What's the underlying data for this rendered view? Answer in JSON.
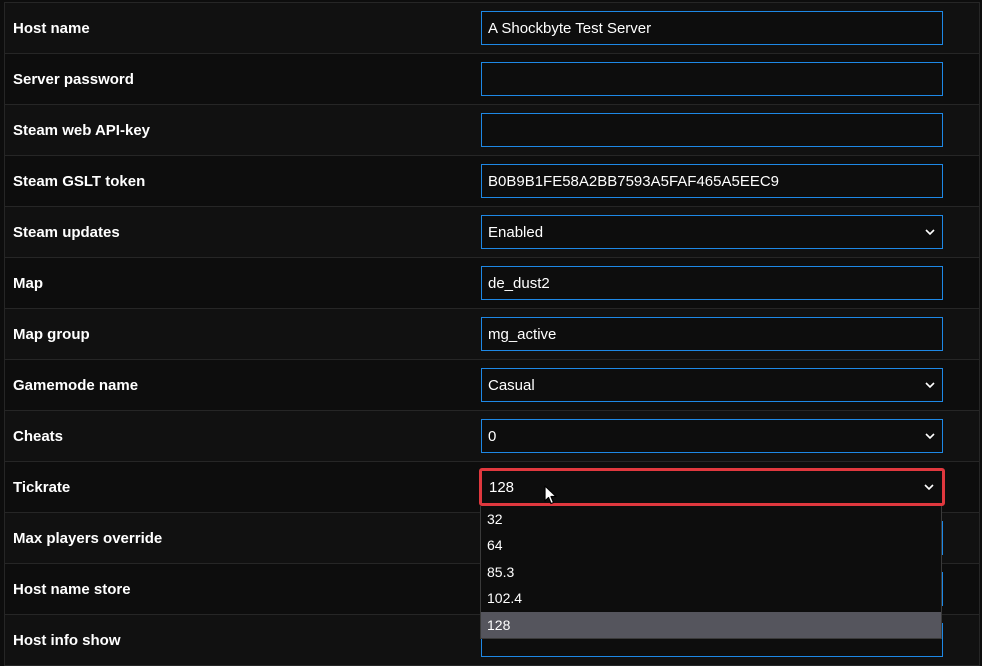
{
  "rows": [
    {
      "label": "Host name",
      "type": "input",
      "value": "A Shockbyte Test Server"
    },
    {
      "label": "Server password",
      "type": "input",
      "value": ""
    },
    {
      "label": "Steam web API-key",
      "type": "input",
      "value": ""
    },
    {
      "label": "Steam GSLT token",
      "type": "input",
      "value": "B0B9B1FE58A2BB7593A5FAF465A5EEC9"
    },
    {
      "label": "Steam updates",
      "type": "select",
      "value": "Enabled"
    },
    {
      "label": "Map",
      "type": "input",
      "value": "de_dust2"
    },
    {
      "label": "Map group",
      "type": "input",
      "value": "mg_active"
    },
    {
      "label": "Gamemode name",
      "type": "select",
      "value": "Casual"
    },
    {
      "label": "Cheats",
      "type": "select",
      "value": "0"
    },
    {
      "label": "Tickrate",
      "type": "select",
      "value": "128"
    },
    {
      "label": "Max players override",
      "type": "input",
      "value": ""
    },
    {
      "label": "Host name store",
      "type": "input",
      "value": ""
    },
    {
      "label": "Host info show",
      "type": "input",
      "value": ""
    }
  ],
  "tickrate_dropdown": {
    "options": [
      "32",
      "64",
      "85.3",
      "102.4",
      "128"
    ],
    "selected": "128"
  },
  "colors": {
    "field_border": "#1e88e5",
    "active_border": "#e0383e",
    "selected_option_bg": "#55555d",
    "background": "#0d0d0d"
  },
  "icons": {
    "select_arrow": "chevron-down-icon",
    "pointer": "mouse-cursor-icon"
  }
}
